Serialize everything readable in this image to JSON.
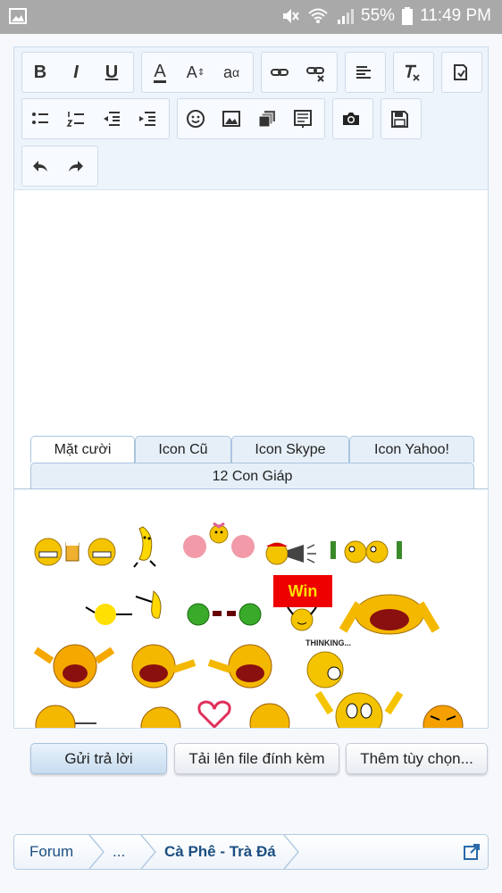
{
  "status_bar": {
    "battery": "55%",
    "time": "11:49 PM"
  },
  "toolbar": {
    "bold": "B",
    "italic": "I",
    "underline": "U",
    "font_color": "A",
    "font_size": "A",
    "font_family": "a"
  },
  "tabs": [
    {
      "label": "Mặt cười"
    },
    {
      "label": "Icon Cũ"
    },
    {
      "label": "Icon Skype"
    },
    {
      "label": "Icon Yahoo!"
    },
    {
      "label": "12 Con Giáp"
    }
  ],
  "smilies": {
    "win_label": "Win",
    "thinking_label": "THINKING..."
  },
  "actions": {
    "reply": "Gửi trả lời",
    "upload": "Tải lên file đính kèm",
    "more": "Thêm tùy chọn..."
  },
  "breadcrumb": {
    "forum": "Forum",
    "ellipsis": "...",
    "current": "Cà Phê - Trà Đá"
  },
  "colors": {
    "accent": "#1c4f82",
    "toolbar_bg": "#eef4fb",
    "status_bar": "#a9a9a9"
  }
}
